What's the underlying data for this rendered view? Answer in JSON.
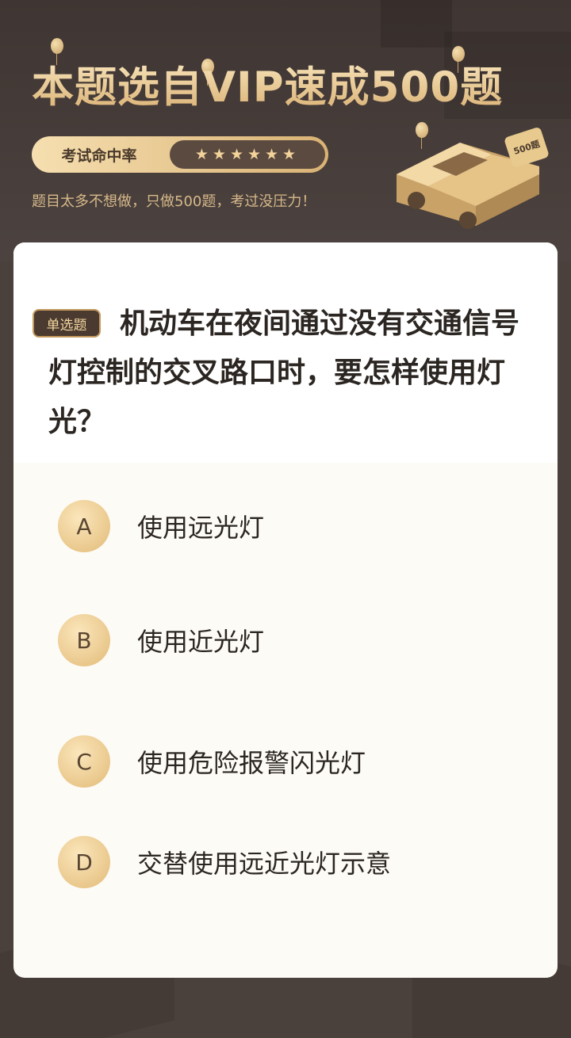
{
  "header": {
    "title": "本题选自VIP速成500题",
    "rate_label": "考试命中率",
    "rate_stars": "★★★★★★",
    "tagline": "题目太多不想做，只做500题，考过没压力！",
    "badge_text": "500题"
  },
  "question": {
    "type_label": "单选题",
    "text": "机动车在夜间通过没有交通信号灯控制的交叉路口时，要怎样使用灯光？"
  },
  "options": [
    {
      "letter": "A",
      "text": "使用远光灯"
    },
    {
      "letter": "B",
      "text": "使用近光灯"
    },
    {
      "letter": "C",
      "text": "使用危险报警闪光灯"
    },
    {
      "letter": "D",
      "text": "交替使用远近光灯示意"
    }
  ]
}
